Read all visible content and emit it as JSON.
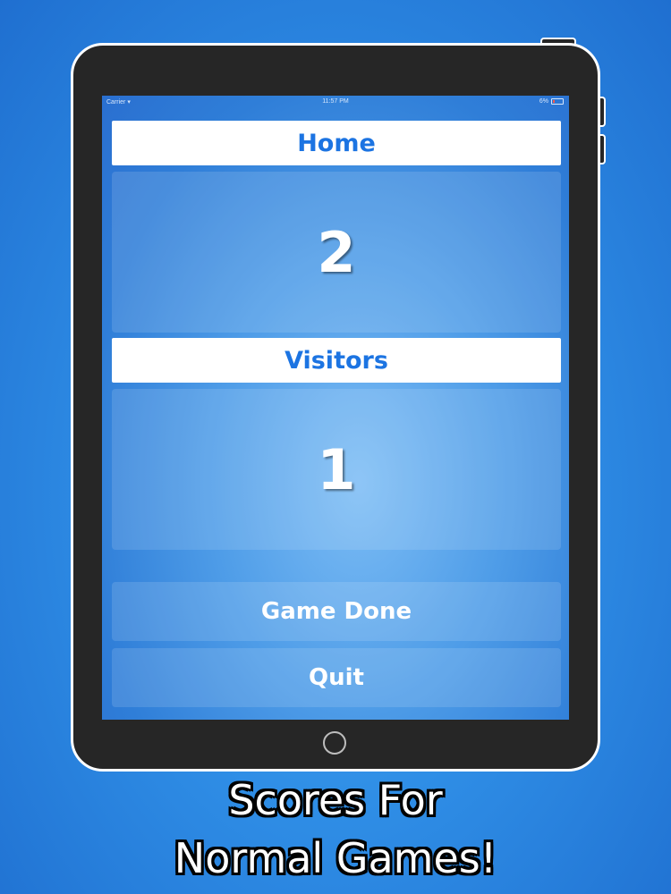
{
  "status_bar": {
    "carrier": "Carrier",
    "time": "11:57 PM",
    "battery": "6%"
  },
  "home": {
    "label": "Home",
    "score": "2"
  },
  "visitors": {
    "label": "Visitors",
    "score": "1"
  },
  "buttons": {
    "game_done": "Game Done",
    "quit": "Quit"
  },
  "caption": {
    "line1": "Scores For",
    "line2": "Normal Games!"
  },
  "colors": {
    "accent": "#1c74e2",
    "background": "#2f8ee6",
    "bezel": "#262626"
  }
}
